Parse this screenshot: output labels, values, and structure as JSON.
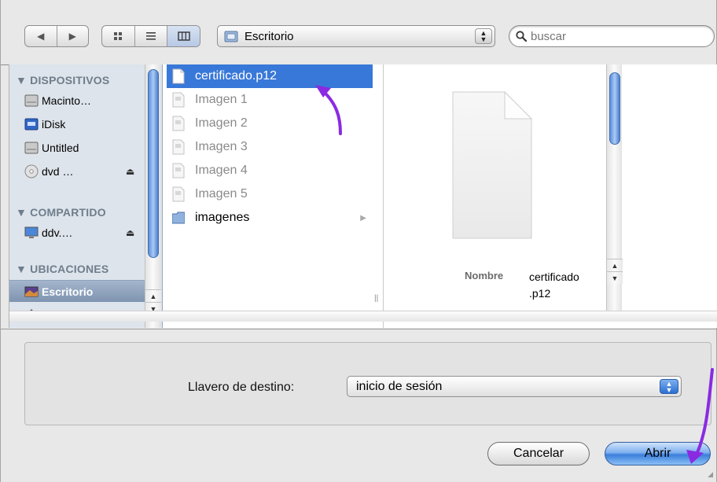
{
  "toolbar": {
    "nav_back_icon": "back-arrow",
    "nav_forward_icon": "forward-arrow",
    "view_modes": [
      "icon-view",
      "list-view",
      "column-view"
    ],
    "selected_view": "column-view",
    "location_label": "Escritorio",
    "search_placeholder": "buscar"
  },
  "sidebar": {
    "sections": [
      {
        "heading": "DISPOSITIVOS",
        "items": [
          {
            "label": "Macinto…",
            "icon": "hard-drive-icon"
          },
          {
            "label": "iDisk",
            "icon": "idisk-icon"
          },
          {
            "label": "Untitled",
            "icon": "hard-drive-icon"
          },
          {
            "label": "dvd …",
            "icon": "dvd-icon",
            "eject": true
          }
        ]
      },
      {
        "heading": "COMPARTIDO",
        "items": [
          {
            "label": "ddv.…",
            "icon": "network-computer-icon",
            "eject": true
          }
        ]
      },
      {
        "heading": "UBICACIONES",
        "items": [
          {
            "label": "Escritorio",
            "icon": "desktop-icon",
            "selected": true
          },
          {
            "label": "atusu",
            "icon": "home-icon"
          }
        ]
      }
    ]
  },
  "files": [
    {
      "name": "certificado.p12",
      "selected": true,
      "enabled": true
    },
    {
      "name": "Imagen 1",
      "enabled": false
    },
    {
      "name": "Imagen 2",
      "enabled": false
    },
    {
      "name": "Imagen 3",
      "enabled": false
    },
    {
      "name": "Imagen 4",
      "enabled": false
    },
    {
      "name": "Imagen 5",
      "enabled": false
    },
    {
      "name": "imagenes",
      "folder": true,
      "enabled": true
    }
  ],
  "preview": {
    "name_key": "Nombre",
    "name_value": "certificado\n.p12"
  },
  "keychain": {
    "label": "Llavero de destino:",
    "selected": "inicio de sesión"
  },
  "buttons": {
    "cancel": "Cancelar",
    "open": "Abrir"
  },
  "colors": {
    "selection": "#3878d9",
    "annotation_arrow": "#8a2be2",
    "sidebar_bg": "#dde4eb"
  }
}
